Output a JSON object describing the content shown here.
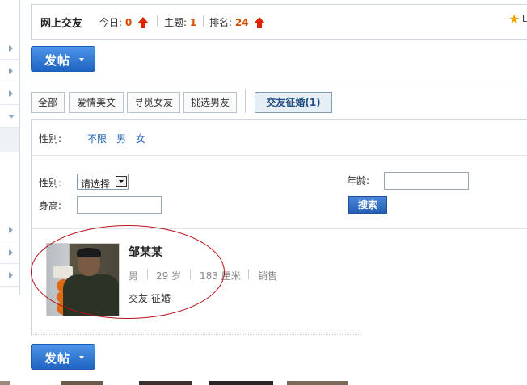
{
  "header": {
    "title": "网上交友",
    "today_label": "今日:",
    "today_value": "0",
    "topics_label": "主题:",
    "topics_value": "1",
    "rank_label": "排名:",
    "rank_value": "24",
    "partial_text": "L"
  },
  "post_button": {
    "label": "发帖"
  },
  "type_tabs": [
    {
      "label": "全部"
    },
    {
      "label": "爱情美文"
    },
    {
      "label": "寻觅女友"
    },
    {
      "label": "挑选男友"
    },
    {
      "label": "交友征婚(1)"
    }
  ],
  "gender_filter": {
    "label": "性别:",
    "options": [
      "不限",
      "男",
      "女"
    ]
  },
  "search_form": {
    "gender_label": "性别:",
    "gender_selected": "请选择",
    "age_label": "年龄:",
    "height_label": "身高:",
    "search_button": "搜索"
  },
  "result": {
    "name": "邹某某",
    "gender": "男",
    "age": "29 岁",
    "height": "183 厘米",
    "occupation": "销售",
    "tags": "交友 征婚"
  },
  "colors": {
    "accent_blue": "#1f64c2",
    "stat_number": "#d64e00",
    "annotation_ellipse": "#b8101a"
  }
}
